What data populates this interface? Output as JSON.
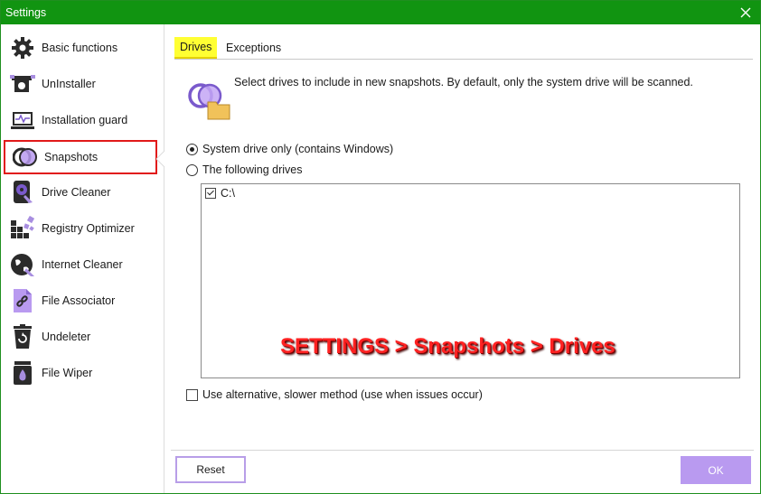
{
  "window": {
    "title": "Settings"
  },
  "sidebar": {
    "items": [
      {
        "label": "Basic functions",
        "icon": "gear-icon"
      },
      {
        "label": "UnInstaller",
        "icon": "uninstaller-icon"
      },
      {
        "label": "Installation guard",
        "icon": "installation-guard-icon"
      },
      {
        "label": "Snapshots",
        "icon": "snapshots-icon",
        "selected": true
      },
      {
        "label": "Drive Cleaner",
        "icon": "drive-cleaner-icon"
      },
      {
        "label": "Registry Optimizer",
        "icon": "registry-optimizer-icon"
      },
      {
        "label": "Internet Cleaner",
        "icon": "internet-cleaner-icon"
      },
      {
        "label": "File Associator",
        "icon": "file-associator-icon"
      },
      {
        "label": "Undeleter",
        "icon": "undeleter-icon"
      },
      {
        "label": "File Wiper",
        "icon": "file-wiper-icon"
      }
    ]
  },
  "tabs": [
    {
      "label": "Drives",
      "active": true
    },
    {
      "label": "Exceptions",
      "active": false
    }
  ],
  "drives_tab": {
    "intro": "Select drives to include in new snapshots. By default, only the system drive will be scanned.",
    "radio_system": "System drive only (contains Windows)",
    "radio_following": "The following drives",
    "drives": [
      {
        "label": "C:\\",
        "checked": true
      }
    ],
    "alt_method": "Use alternative, slower method (use when issues occur)"
  },
  "overlay_caption": "SETTINGS > Snapshots > Drives",
  "buttons": {
    "reset": "Reset",
    "ok": "OK"
  },
  "colors": {
    "titlebar": "#119411",
    "accent": "#b99af0",
    "selection_border": "#e11919",
    "tab_highlight": "#ffff33"
  }
}
